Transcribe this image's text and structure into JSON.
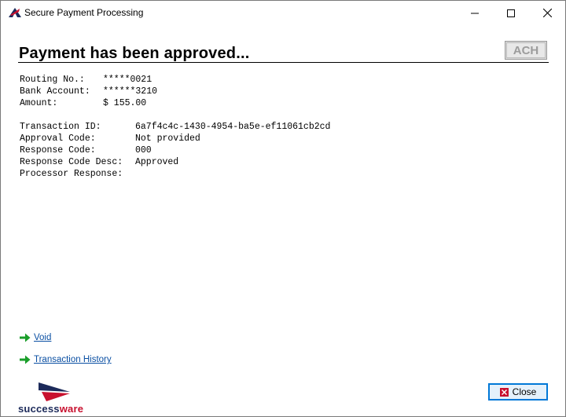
{
  "window": {
    "title": "Secure Payment Processing"
  },
  "header": {
    "heading": "Payment has been approved...",
    "badge": "ACH"
  },
  "account": {
    "routing_label": "Routing No.:",
    "routing_value": "*****0021",
    "bank_label": "Bank Account:",
    "bank_value": "******3210",
    "amount_label": "Amount:",
    "amount_value": "$ 155.00"
  },
  "transaction": {
    "id_label": "Transaction ID:",
    "id_value": "6a7f4c4c-1430-4954-ba5e-ef11061cb2cd",
    "approval_label": "Approval Code:",
    "approval_value": "Not provided",
    "response_label": "Response Code:",
    "response_value": "000",
    "desc_label": "Response Code Desc:",
    "desc_value": "Approved",
    "processor_label": "Processor Response:",
    "processor_value": ""
  },
  "links": {
    "void": "Void",
    "history": "Transaction History"
  },
  "footer": {
    "brand_a": "success",
    "brand_b": "ware",
    "close_label": "Close"
  },
  "colors": {
    "link": "#0a4fa3",
    "arrow": "#1a9e2a",
    "brand_navy": "#1c2a5a",
    "brand_red": "#c8102e"
  }
}
